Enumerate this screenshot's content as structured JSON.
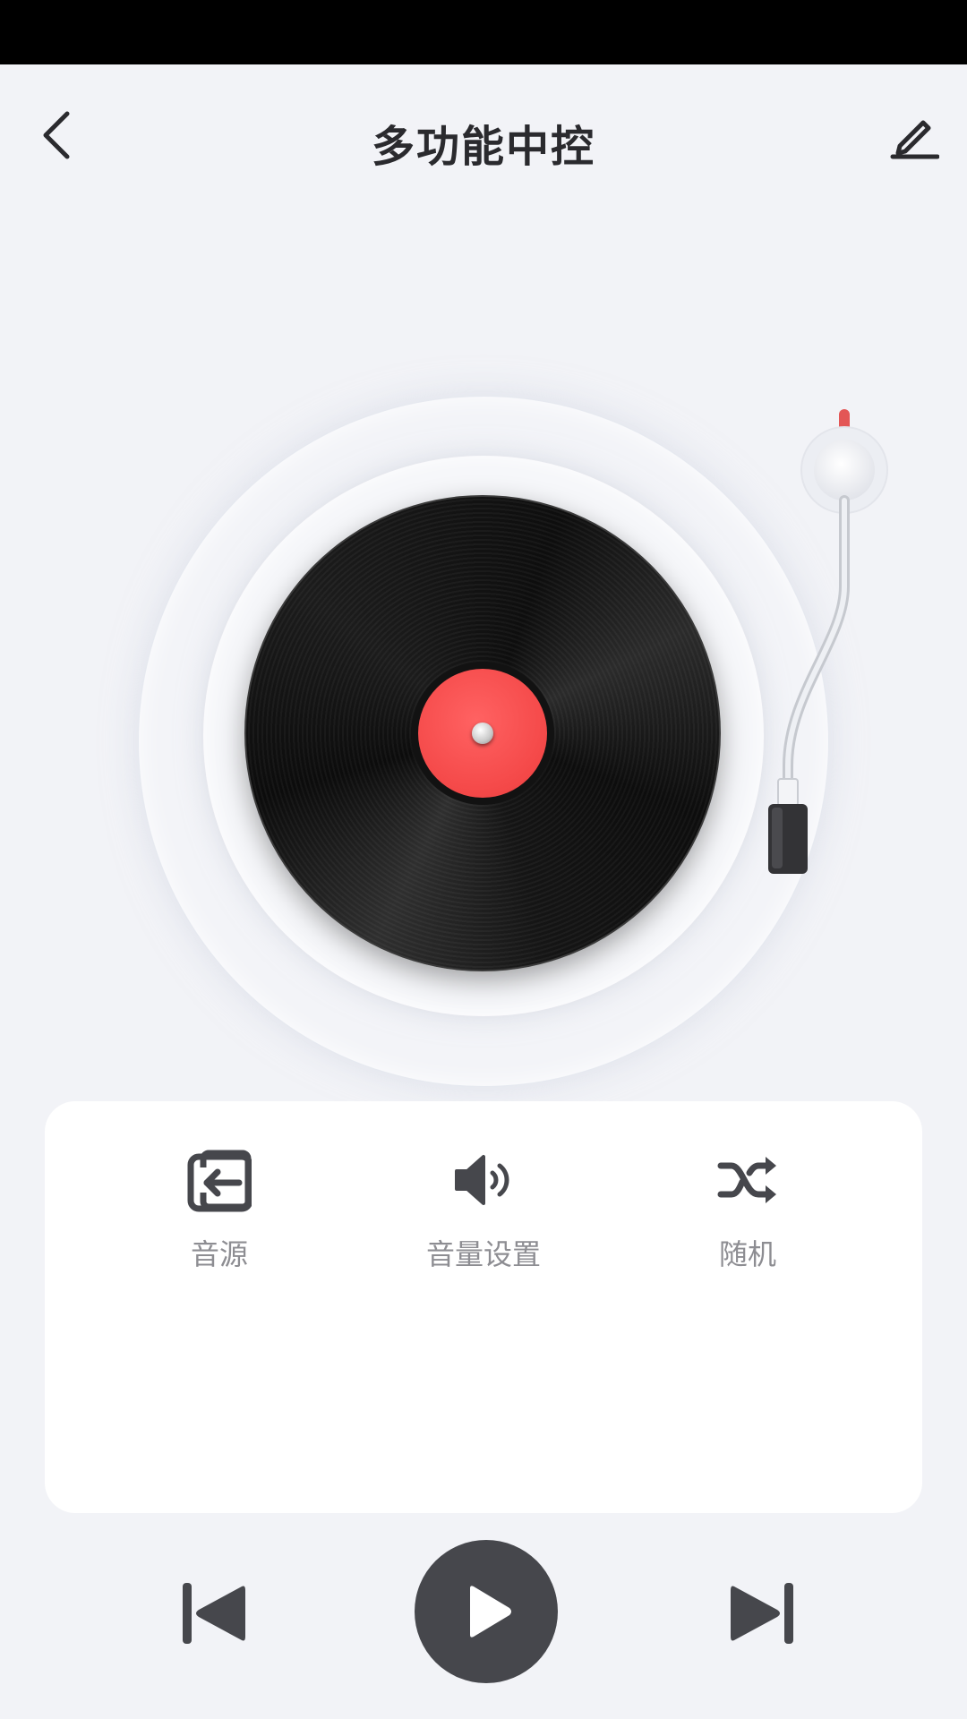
{
  "header": {
    "title": "多功能中控",
    "back_icon": "chevron-left-icon",
    "edit_icon": "pencil-icon"
  },
  "player": {
    "record_label_color": "#f44848",
    "state": "paused"
  },
  "functions": [
    {
      "label": "音源",
      "icon": "input-source-icon"
    },
    {
      "label": "音量设置",
      "icon": "volume-icon"
    },
    {
      "label": "随机",
      "icon": "shuffle-icon"
    }
  ],
  "controls": {
    "previous_icon": "skip-previous-icon",
    "play_icon": "play-icon",
    "next_icon": "skip-next-icon"
  },
  "colors": {
    "background": "#f2f3f7",
    "icon_dark": "#46474c",
    "accent_red": "#f44848"
  }
}
